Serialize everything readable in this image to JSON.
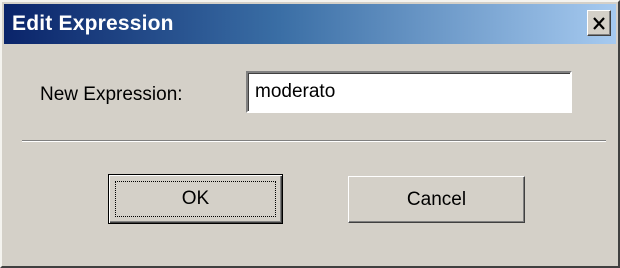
{
  "window": {
    "title": "Edit Expression",
    "close_icon": "close-icon"
  },
  "form": {
    "label": "New Expression:",
    "value": "moderato"
  },
  "buttons": {
    "ok_label": "OK",
    "cancel_label": "Cancel"
  },
  "colors": {
    "face": "#d4d0c8",
    "title_start": "#0a246a",
    "title_end": "#a6caf0"
  }
}
